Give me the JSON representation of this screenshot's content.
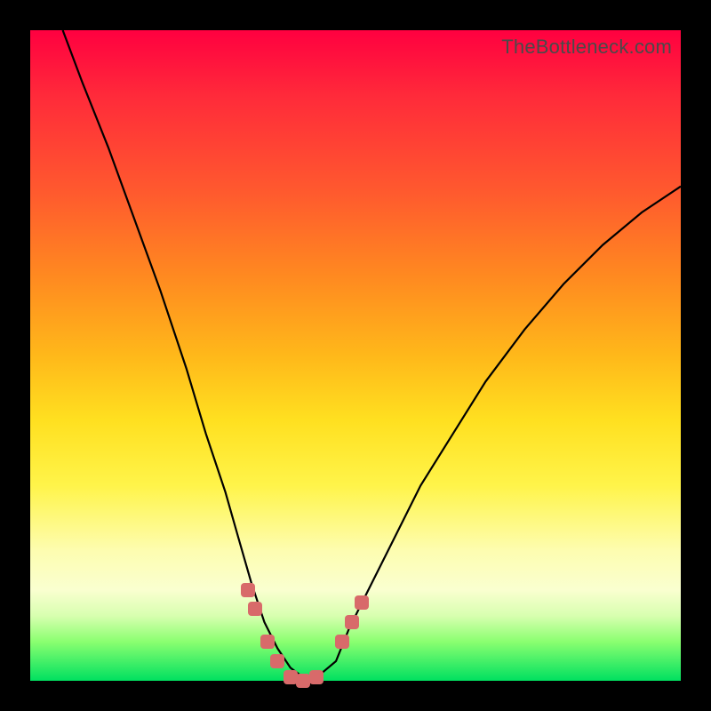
{
  "watermark": "TheBottleneck.com",
  "chart_data": {
    "type": "line",
    "title": "",
    "xlabel": "",
    "ylabel": "",
    "xlim": [
      0,
      100
    ],
    "ylim": [
      0,
      100
    ],
    "series": [
      {
        "name": "bottleneck-curve",
        "x": [
          5,
          8,
          12,
          16,
          20,
          24,
          27,
          30,
          32,
          34,
          36,
          38,
          40,
          42,
          43,
          44,
          47,
          49,
          52,
          56,
          60,
          65,
          70,
          76,
          82,
          88,
          94,
          100
        ],
        "y": [
          100,
          92,
          82,
          71,
          60,
          48,
          38,
          29,
          22,
          15,
          9,
          5,
          2,
          0.5,
          0,
          0.5,
          3,
          8,
          14,
          22,
          30,
          38,
          46,
          54,
          61,
          67,
          72,
          76
        ]
      }
    ],
    "markers": [
      {
        "name": "left-cluster-1",
        "x": 33.5,
        "y": 14
      },
      {
        "name": "left-cluster-2",
        "x": 34.5,
        "y": 11
      },
      {
        "name": "left-cluster-3",
        "x": 36.5,
        "y": 6
      },
      {
        "name": "left-cluster-4",
        "x": 38,
        "y": 3
      },
      {
        "name": "trough-1",
        "x": 40,
        "y": 0.5
      },
      {
        "name": "trough-2",
        "x": 42,
        "y": 0
      },
      {
        "name": "trough-3",
        "x": 44,
        "y": 0.5
      },
      {
        "name": "right-cluster-1",
        "x": 48,
        "y": 6
      },
      {
        "name": "right-cluster-2",
        "x": 49.5,
        "y": 9
      },
      {
        "name": "right-cluster-3",
        "x": 51,
        "y": 12
      }
    ],
    "marker_color": "#d86a6a",
    "gradient_stops": [
      {
        "pos": 0,
        "color": "#ff0040"
      },
      {
        "pos": 25,
        "color": "#ff5a2e"
      },
      {
        "pos": 50,
        "color": "#ffb81a"
      },
      {
        "pos": 70,
        "color": "#fff44a"
      },
      {
        "pos": 86,
        "color": "#faffd0"
      },
      {
        "pos": 100,
        "color": "#00e060"
      }
    ]
  }
}
